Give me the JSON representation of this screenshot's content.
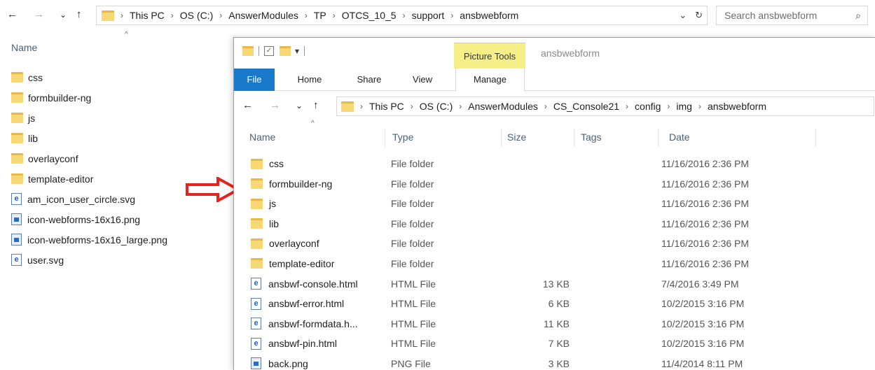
{
  "outer": {
    "nav": {
      "back": "←",
      "forward": "→",
      "recent": "⌄",
      "up": "↑"
    },
    "breadcrumb": [
      "This PC",
      "OS (C:)",
      "AnswerModules",
      "TP",
      "OTCS_10_5",
      "support",
      "ansbwebform"
    ],
    "addr_dropdown": "⌄",
    "refresh": "↻",
    "search_placeholder": "Search ansbwebform",
    "search_icon": "⌕",
    "sort_caret": "^",
    "column_name": "Name",
    "items": [
      {
        "name": "css",
        "kind": "folder"
      },
      {
        "name": "formbuilder-ng",
        "kind": "folder"
      },
      {
        "name": "js",
        "kind": "folder"
      },
      {
        "name": "lib",
        "kind": "folder"
      },
      {
        "name": "overlayconf",
        "kind": "folder"
      },
      {
        "name": "template-editor",
        "kind": "folder"
      },
      {
        "name": "am_icon_user_circle.svg",
        "kind": "svg"
      },
      {
        "name": "icon-webforms-16x16.png",
        "kind": "png"
      },
      {
        "name": "icon-webforms-16x16_large.png",
        "kind": "png"
      },
      {
        "name": "user.svg",
        "kind": "svg"
      }
    ]
  },
  "colors": {
    "arrow": "#e8231c",
    "file_tab": "#1979ca",
    "picture_tools": "#f4f087",
    "folder": "#f8d775"
  },
  "inner": {
    "qat_pin": "▾",
    "qat_check": "✓",
    "picture_tools": "Picture Tools",
    "window_title": "ansbwebform",
    "tabs": {
      "file": "File",
      "home": "Home",
      "share": "Share",
      "view": "View",
      "manage": "Manage"
    },
    "nav": {
      "back": "←",
      "forward": "→",
      "recent": "⌄",
      "up": "↑"
    },
    "breadcrumb": [
      "This PC",
      "OS (C:)",
      "AnswerModules",
      "CS_Console21",
      "config",
      "img",
      "ansbwebform"
    ],
    "sort_caret": "^",
    "columns": {
      "name": "Name",
      "type": "Type",
      "size": "Size",
      "tags": "Tags",
      "date": "Date"
    },
    "rows": [
      {
        "name": "css",
        "kind": "folder",
        "type": "File folder",
        "size": "",
        "date": "11/16/2016 2:36 PM"
      },
      {
        "name": "formbuilder-ng",
        "kind": "folder",
        "type": "File folder",
        "size": "",
        "date": "11/16/2016 2:36 PM"
      },
      {
        "name": "js",
        "kind": "folder",
        "type": "File folder",
        "size": "",
        "date": "11/16/2016 2:36 PM"
      },
      {
        "name": "lib",
        "kind": "folder",
        "type": "File folder",
        "size": "",
        "date": "11/16/2016 2:36 PM"
      },
      {
        "name": "overlayconf",
        "kind": "folder",
        "type": "File folder",
        "size": "",
        "date": "11/16/2016 2:36 PM"
      },
      {
        "name": "template-editor",
        "kind": "folder",
        "type": "File folder",
        "size": "",
        "date": "11/16/2016 2:36 PM"
      },
      {
        "name": "ansbwf-console.html",
        "kind": "html",
        "type": "HTML File",
        "size": "13 KB",
        "date": "7/4/2016 3:49 PM"
      },
      {
        "name": "ansbwf-error.html",
        "kind": "html",
        "type": "HTML File",
        "size": "6 KB",
        "date": "10/2/2015 3:16 PM"
      },
      {
        "name": "ansbwf-formdata.h...",
        "kind": "html",
        "type": "HTML File",
        "size": "11 KB",
        "date": "10/2/2015 3:16 PM"
      },
      {
        "name": "ansbwf-pin.html",
        "kind": "html",
        "type": "HTML File",
        "size": "7 KB",
        "date": "10/2/2015 3:16 PM"
      },
      {
        "name": "back.png",
        "kind": "png",
        "type": "PNG File",
        "size": "3 KB",
        "date": "11/4/2014 8:11 PM"
      }
    ]
  }
}
